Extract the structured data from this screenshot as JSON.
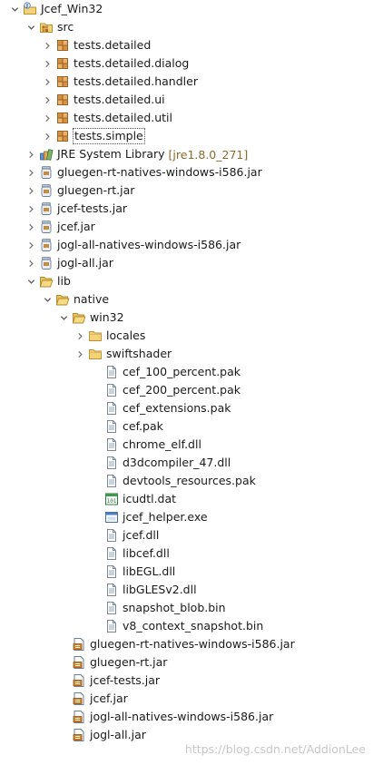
{
  "tree": [
    {
      "label": "Jcef_Win32",
      "icon": "project-icon",
      "depth": 0,
      "twisty": "expanded"
    },
    {
      "label": "src",
      "icon": "source-folder-icon",
      "depth": 1,
      "twisty": "expanded"
    },
    {
      "label": "tests.detailed",
      "icon": "package-icon",
      "depth": 2,
      "twisty": "collapsed"
    },
    {
      "label": "tests.detailed.dialog",
      "icon": "package-icon",
      "depth": 2,
      "twisty": "collapsed"
    },
    {
      "label": "tests.detailed.handler",
      "icon": "package-icon",
      "depth": 2,
      "twisty": "collapsed"
    },
    {
      "label": "tests.detailed.ui",
      "icon": "package-icon",
      "depth": 2,
      "twisty": "collapsed"
    },
    {
      "label": "tests.detailed.util",
      "icon": "package-icon",
      "depth": 2,
      "twisty": "collapsed"
    },
    {
      "label": "tests.simple",
      "icon": "package-icon",
      "depth": 2,
      "twisty": "collapsed",
      "selected": true
    },
    {
      "label": "JRE System Library",
      "decoration": "[jre1.8.0_271]",
      "icon": "library-icon",
      "depth": 1,
      "twisty": "collapsed"
    },
    {
      "label": "gluegen-rt-natives-windows-i586.jar",
      "icon": "jar-reference-icon",
      "depth": 1,
      "twisty": "collapsed"
    },
    {
      "label": "gluegen-rt.jar",
      "icon": "jar-reference-icon",
      "depth": 1,
      "twisty": "collapsed"
    },
    {
      "label": "jcef-tests.jar",
      "icon": "jar-reference-icon",
      "depth": 1,
      "twisty": "collapsed"
    },
    {
      "label": "jcef.jar",
      "icon": "jar-reference-icon",
      "depth": 1,
      "twisty": "collapsed"
    },
    {
      "label": "jogl-all-natives-windows-i586.jar",
      "icon": "jar-reference-icon",
      "depth": 1,
      "twisty": "collapsed"
    },
    {
      "label": "jogl-all.jar",
      "icon": "jar-reference-icon",
      "depth": 1,
      "twisty": "collapsed"
    },
    {
      "label": "lib",
      "icon": "folder-open-icon",
      "depth": 1,
      "twisty": "expanded"
    },
    {
      "label": "native",
      "icon": "folder-open-icon",
      "depth": 2,
      "twisty": "expanded"
    },
    {
      "label": "win32",
      "icon": "folder-open-icon",
      "depth": 3,
      "twisty": "expanded"
    },
    {
      "label": "locales",
      "icon": "folder-icon",
      "depth": 4,
      "twisty": "collapsed"
    },
    {
      "label": "swiftshader",
      "icon": "folder-icon",
      "depth": 4,
      "twisty": "collapsed"
    },
    {
      "label": "cef_100_percent.pak",
      "icon": "file-icon",
      "depth": 5,
      "twisty": "none"
    },
    {
      "label": "cef_200_percent.pak",
      "icon": "file-icon",
      "depth": 5,
      "twisty": "none"
    },
    {
      "label": "cef_extensions.pak",
      "icon": "file-icon",
      "depth": 5,
      "twisty": "none"
    },
    {
      "label": "cef.pak",
      "icon": "file-icon",
      "depth": 5,
      "twisty": "none"
    },
    {
      "label": "chrome_elf.dll",
      "icon": "file-icon",
      "depth": 5,
      "twisty": "none"
    },
    {
      "label": "d3dcompiler_47.dll",
      "icon": "file-icon",
      "depth": 5,
      "twisty": "none"
    },
    {
      "label": "devtools_resources.pak",
      "icon": "file-icon",
      "depth": 5,
      "twisty": "none"
    },
    {
      "label": "icudtl.dat",
      "icon": "dat-file-icon",
      "depth": 5,
      "twisty": "none"
    },
    {
      "label": "jcef_helper.exe",
      "icon": "exe-file-icon",
      "depth": 5,
      "twisty": "none"
    },
    {
      "label": "jcef.dll",
      "icon": "file-icon",
      "depth": 5,
      "twisty": "none"
    },
    {
      "label": "libcef.dll",
      "icon": "file-icon",
      "depth": 5,
      "twisty": "none"
    },
    {
      "label": "libEGL.dll",
      "icon": "file-icon",
      "depth": 5,
      "twisty": "none"
    },
    {
      "label": "libGLESv2.dll",
      "icon": "file-icon",
      "depth": 5,
      "twisty": "none"
    },
    {
      "label": "snapshot_blob.bin",
      "icon": "file-icon",
      "depth": 5,
      "twisty": "none"
    },
    {
      "label": "v8_context_snapshot.bin",
      "icon": "file-icon",
      "depth": 5,
      "twisty": "none"
    },
    {
      "label": "gluegen-rt-natives-windows-i586.jar",
      "icon": "jar-file-icon",
      "depth": 3,
      "twisty": "none"
    },
    {
      "label": "gluegen-rt.jar",
      "icon": "jar-file-icon",
      "depth": 3,
      "twisty": "none"
    },
    {
      "label": "jcef-tests.jar",
      "icon": "jar-file-icon",
      "depth": 3,
      "twisty": "none"
    },
    {
      "label": "jcef.jar",
      "icon": "jar-file-icon",
      "depth": 3,
      "twisty": "none"
    },
    {
      "label": "jogl-all-natives-windows-i586.jar",
      "icon": "jar-file-icon",
      "depth": 3,
      "twisty": "none"
    },
    {
      "label": "jogl-all.jar",
      "icon": "jar-file-icon",
      "depth": 3,
      "twisty": "none"
    }
  ],
  "watermark": "https://blog.csdn.net/AddionLee"
}
